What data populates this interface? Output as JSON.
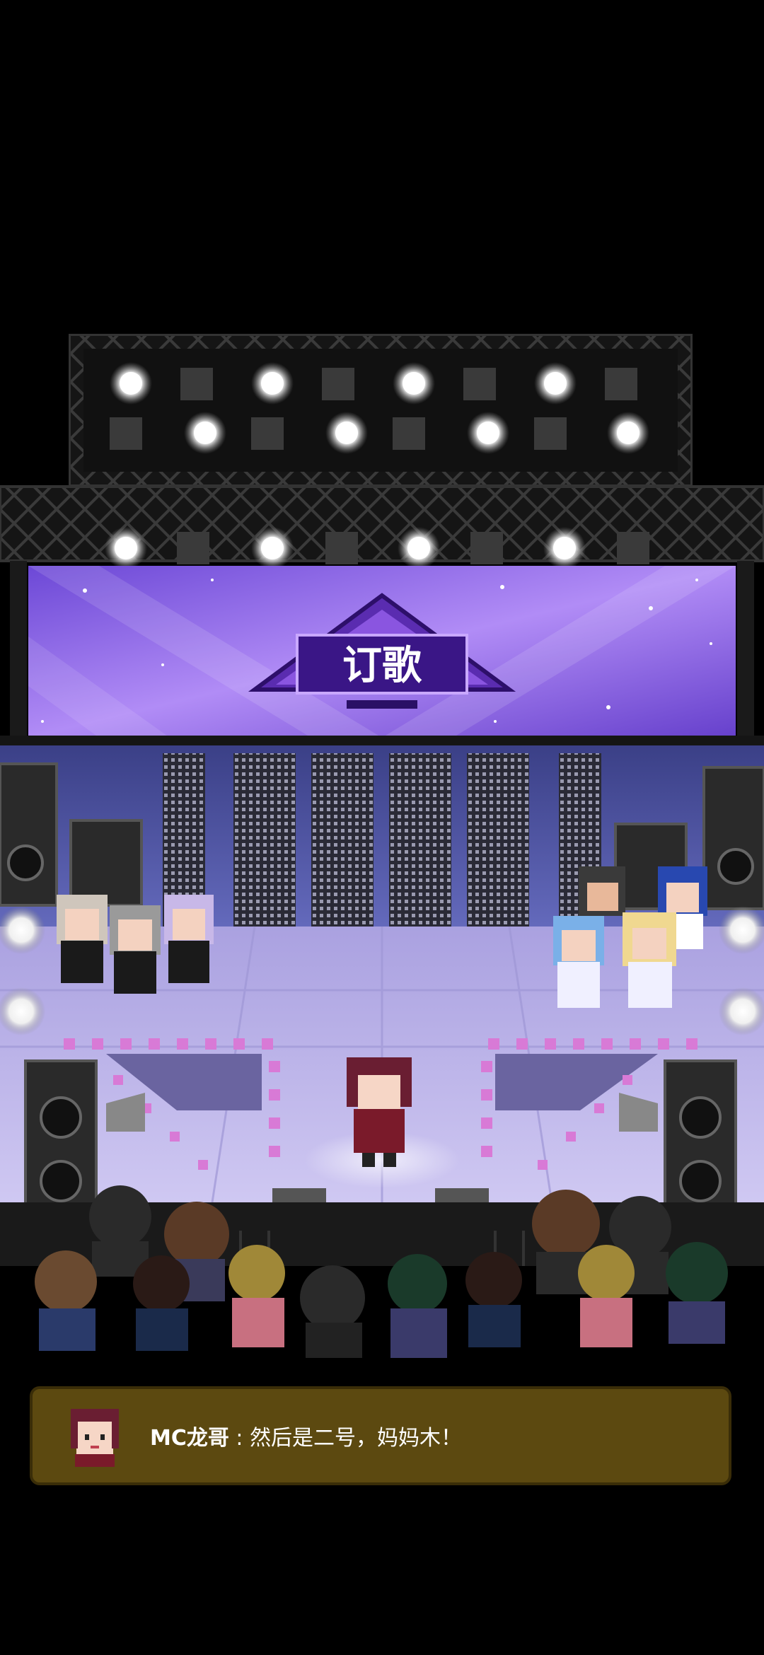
{
  "show": {
    "logo_text": "订歌"
  },
  "dialog": {
    "speaker": "MC龙哥",
    "separator": " : ",
    "line": "然后是二号，妈妈木！"
  },
  "colors": {
    "dialog_bg": "#5c4910",
    "screen_purple": "#8a62ec",
    "stage_floor": "#bfb6ea",
    "truss": "#1e1e1e"
  }
}
